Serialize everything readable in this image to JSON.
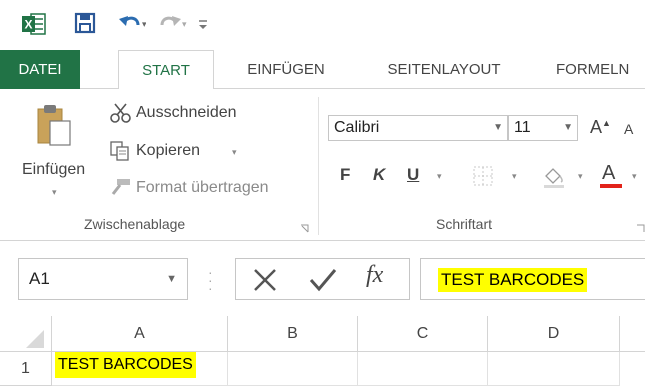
{
  "quick_access": {
    "icons": [
      "excel-logo-icon",
      "save-icon",
      "undo-icon",
      "redo-icon",
      "customize-qat-icon"
    ],
    "app_letter": "X"
  },
  "tabs": [
    {
      "label": "DATEI",
      "state": "file"
    },
    {
      "label": "START",
      "state": "active"
    },
    {
      "label": "EINFÜGEN",
      "state": ""
    },
    {
      "label": "SEITENLAYOUT",
      "state": ""
    },
    {
      "label": "FORMELN",
      "state": ""
    }
  ],
  "clipboard": {
    "paste_label": "Einfügen",
    "cut_label": "Ausschneiden",
    "copy_label": "Kopieren",
    "format_painter_label": "Format übertragen",
    "group_label": "Zwischenablage"
  },
  "font": {
    "font_name": "Calibri",
    "font_size": "11",
    "bold": "F",
    "italic": "K",
    "underline": "U",
    "group_label": "Schriftart",
    "grow_label": "A",
    "shrink_label": "A",
    "font_color_label": "A"
  },
  "formula_bar": {
    "name_box": "A1",
    "fx_label": "fx",
    "content": "TEST BARCODES"
  },
  "grid": {
    "columns": [
      "A",
      "B",
      "C",
      "D"
    ],
    "rows": [
      {
        "number": "1",
        "cells": [
          "TEST BARCODES",
          "",
          "",
          ""
        ]
      }
    ]
  },
  "colors": {
    "excel_green": "#217346",
    "highlight": "#ffff00",
    "font_color_red": "#e2231a"
  }
}
